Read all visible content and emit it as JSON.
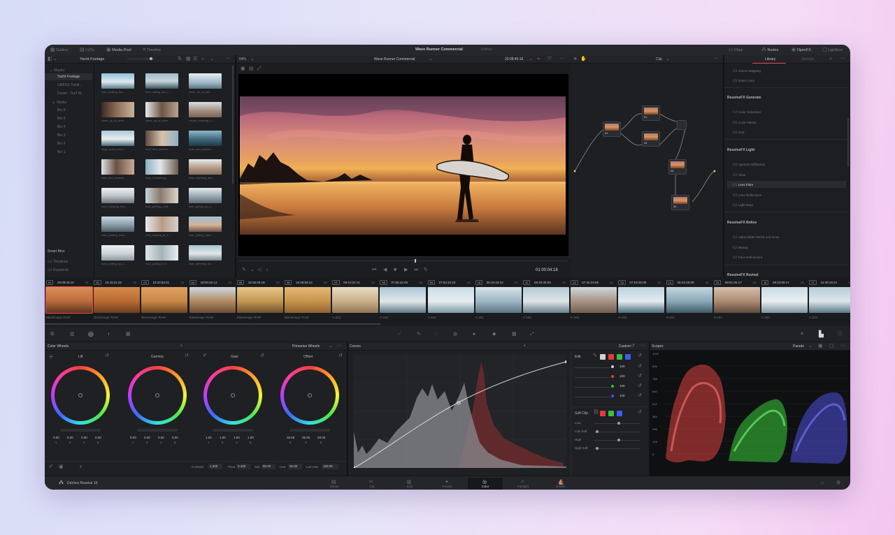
{
  "topbar": {
    "left": [
      "Gallery",
      "LUTs",
      "Media Pool",
      "Timeline"
    ],
    "title": "Wave Runner Commercial",
    "status": "Edited",
    "right": [
      "Clips",
      "Nodes",
      "OpenFX",
      "Lightbox"
    ]
  },
  "media_pool": {
    "bin_title": "Yacht Footage",
    "tree": [
      "Master",
      "Yacht Footage",
      "UMFG3 Trenti...",
      "Footer - Surf W...",
      "Media",
      "Bin 5",
      "Bin 6",
      "Bin 4",
      "Bin 3",
      "Bin 2",
      "Bin 1"
    ],
    "smart_bins_title": "Smart Bins",
    "smart_bins": [
      "Timelines",
      "Keywords"
    ],
    "thumbs": [
      "club_boating_tha...",
      "men_sailing_km_r...",
      "close_up_of_beli...",
      "close_up_of_wom...",
      "close_up_of_wom...",
      "couple_relaxing_o...",
      "large_boat_movin...",
      "man_and_woman...",
      "man_and_woman...",
      "man_and_woman...",
      "man_embarking...",
      "man_enjoying_sea...",
      "man_enjoying_sea...",
      "man_getting_read...",
      "man_giving_an_o...",
      "man_looking_dock...",
      "man_looking_at_s...",
      "man_pulling_rope...",
      "man_pulling_up_s...",
      "man_pulling_it_fr...",
      "man_steering_wh..."
    ]
  },
  "viewer": {
    "zoom": "54%",
    "timeline_name": "Wave Runner Commercial",
    "timecode": "20:08:45:16",
    "clip_label": "Clip",
    "timecode_bottom": "01:00:04:18"
  },
  "library": {
    "tab_active": "Library",
    "tab_other": "Settings",
    "items_top": [
      "Gamut Mapping",
      "Invert Color"
    ],
    "sections": [
      {
        "title": "ResolveFX Generate",
        "items": [
          "Color Generator",
          "Color Palette",
          "Grid"
        ]
      },
      {
        "title": "ResolveFX Light",
        "items": [
          "Aperture Diffraction",
          "Glow",
          "Lens Flare",
          "Lens Reflections",
          "Light Rays"
        ]
      },
      {
        "title": "ResolveFX Refine",
        "items": [
          "Alpha Matte Shrink and Grow",
          "Beauty",
          "Face Refinement"
        ]
      }
    ],
    "footer": "ResolveFX Revival"
  },
  "nodes": [
    "01",
    "02",
    "03",
    "04",
    "05",
    "06"
  ],
  "timeline": {
    "clips": [
      {
        "num": "01",
        "tc": "20:08:46:10",
        "track": "V1",
        "codec": "Blackmagic RAW"
      },
      {
        "num": "02",
        "tc": "19:43:21:02",
        "track": "V1",
        "codec": "Blackmagic RAW"
      },
      {
        "num": "03",
        "tc": "19:33:53:01",
        "track": "V1",
        "codec": "Blackmagic RAW"
      },
      {
        "num": "04",
        "tc": "18:00:22:13",
        "track": "V1",
        "codec": "Blackmagic RAW"
      },
      {
        "num": "05",
        "tc": "18:36:29:18",
        "track": "V2",
        "codec": "Blackmagic RAW"
      },
      {
        "num": "06",
        "tc": "18:38:59:14",
        "track": "V2",
        "codec": "Blackmagic RAW"
      },
      {
        "num": "07",
        "tc": "08:10:21:11",
        "track": "V1",
        "codec": "H.264"
      },
      {
        "num": "08",
        "tc": "07:55:42:00",
        "track": "V1",
        "codec": "H.264"
      },
      {
        "num": "09",
        "tc": "07:52:10:23",
        "track": "V1",
        "codec": "H.264"
      },
      {
        "num": "10",
        "tc": "06:10:43:10",
        "track": "V1",
        "codec": "H.264"
      },
      {
        "num": "11",
        "tc": "08:29:38:09",
        "track": "V1",
        "codec": "H.264"
      },
      {
        "num": "12",
        "tc": "07:44:24:06",
        "track": "V1",
        "codec": "H.264"
      },
      {
        "num": "13",
        "tc": "07:53:26:08",
        "track": "V1",
        "codec": "H.264"
      },
      {
        "num": "14",
        "tc": "08:43:45:09",
        "track": "V1",
        "codec": "H.264"
      },
      {
        "num": "15",
        "tc": "08:51:05:17",
        "track": "V1",
        "codec": "H.264"
      },
      {
        "num": "16",
        "tc": "08:23:59:17",
        "track": "V1",
        "codec": "H.264"
      },
      {
        "num": "17",
        "tc": "12:30:19:24",
        "track": "V1",
        "codec": "H.264"
      }
    ]
  },
  "color_wheels": {
    "title": "Color Wheels",
    "mode": "Primaries Wheels",
    "wheels": [
      {
        "name": "Lift",
        "values": [
          "0.00",
          "0.00",
          "0.00",
          "0.00"
        ]
      },
      {
        "name": "Gamma",
        "values": [
          "0.00",
          "0.00",
          "0.00",
          "0.00"
        ]
      },
      {
        "name": "Gain",
        "values": [
          "1.00",
          "1.00",
          "1.00",
          "1.00"
        ]
      },
      {
        "name": "Offset",
        "values": [
          "25.00",
          "25.00",
          "25.00",
          ""
        ]
      }
    ],
    "channel_labels": [
      "Y",
      "R",
      "G",
      "B"
    ],
    "footer_page": "2",
    "params": [
      {
        "label": "Contrast",
        "value": "1.000"
      },
      {
        "label": "Pivot",
        "value": "0.435"
      },
      {
        "label": "Sat",
        "value": "50.00"
      },
      {
        "label": "Hue",
        "value": "50.00"
      },
      {
        "label": "Lum Mix",
        "value": "100.00"
      }
    ]
  },
  "curves": {
    "title": "Curves",
    "mode": "Custom",
    "edit_label": "Edit",
    "channels": [
      {
        "label": "Y",
        "value": "100"
      },
      {
        "label": "R",
        "value": "100"
      },
      {
        "label": "G",
        "value": "100"
      },
      {
        "label": "B",
        "value": "100"
      }
    ],
    "soft_clip": "Soft Clip",
    "soft_items": [
      "Low",
      "Low Soft",
      "High",
      "High Soft"
    ]
  },
  "scopes": {
    "title": "Scopes",
    "mode": "Parade",
    "ticks": [
      "1023",
      "896",
      "768",
      "640",
      "512",
      "384",
      "256",
      "128",
      "0"
    ]
  },
  "pagebar": {
    "app": "DaVinci Resolve 16",
    "pages": [
      "Media",
      "Cut",
      "Edit",
      "Fusion",
      "Color",
      "Fairlight",
      "Deliver"
    ],
    "active": "Color"
  },
  "colors": {
    "accent": "#e84a4a",
    "scope_red": "#ff4a4a",
    "scope_green": "#43ff43",
    "scope_blue": "#5a5aff"
  }
}
